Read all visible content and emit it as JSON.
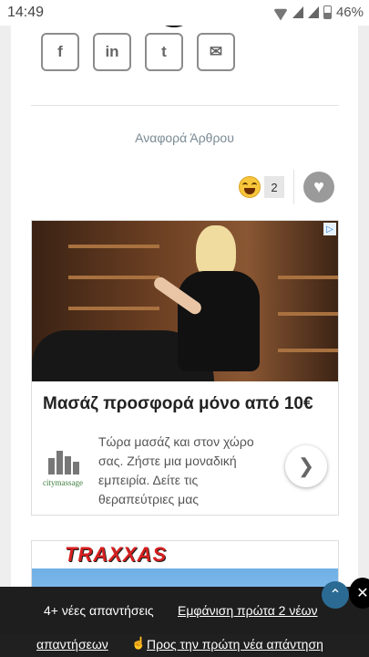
{
  "status": {
    "time": "14:49",
    "battery": "46%"
  },
  "share": {
    "facebook": "f",
    "linkedin": "in",
    "twitter": "t",
    "email": "✉"
  },
  "article": {
    "report_label": "Αναφορά Άρθρου"
  },
  "reactions": {
    "count": "2"
  },
  "ad": {
    "headline": "Μασάζ προσφορά μόνο από 10€",
    "description": "Τώρα μασάζ και στον χώρο σας. Ζήστε μια μοναδική εμπειρία. Δείτε τις θεραπεύτριες μας",
    "logo_text": "citymassage",
    "adchoices": "▷"
  },
  "ad2": {
    "brand": "TRAXXAS"
  },
  "toast": {
    "message": "4+ νέες απαντήσεις",
    "link": "Εμφάνιση πρώτα 2 νέων"
  },
  "bottom": {
    "link_a": "απαντήσεων",
    "link_b": "Προς την πρώτη νέα απάντηση"
  }
}
